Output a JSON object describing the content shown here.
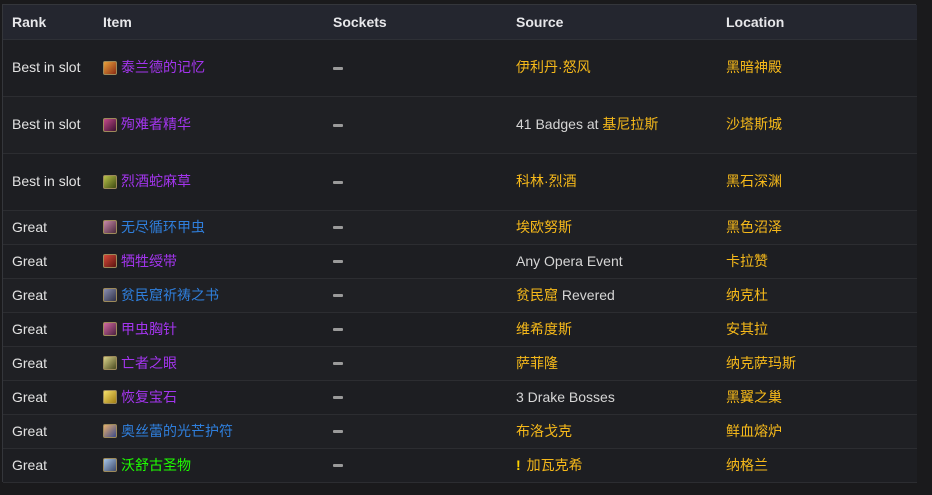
{
  "columns": [
    "Rank",
    "Item",
    "Sockets",
    "Source",
    "Location"
  ],
  "colors": {
    "epic": "#a335ee",
    "rare": "#2f7fdd",
    "uncommon": "#1eff00",
    "gold_link": "#f6b91a",
    "header_bg": "#24262f",
    "row_bg": "#1d1e22"
  },
  "rows": [
    {
      "rank": "Best in slot",
      "item": "泰兰德的记忆",
      "item_quality": "epic",
      "icon": "tear-icon",
      "sockets": "—",
      "source_parts": [
        {
          "text": "伊利丹·怒风",
          "style": "gold"
        }
      ],
      "location": "黑暗神殿"
    },
    {
      "rank": "Best in slot",
      "item": "殉难者精华",
      "item_quality": "epic",
      "icon": "essence-icon",
      "sockets": "—",
      "source_parts": [
        {
          "text": "41 Badges at ",
          "style": "plain"
        },
        {
          "text": "基尼拉斯",
          "style": "gold"
        }
      ],
      "location": "沙塔斯城"
    },
    {
      "rank": "Best in slot",
      "item": "烈酒蛇麻草",
      "item_quality": "epic",
      "icon": "hops-icon",
      "sockets": "—",
      "source_parts": [
        {
          "text": "科林·烈酒",
          "style": "gold"
        }
      ],
      "location": "黑石深渊"
    },
    {
      "rank": "Great",
      "item": "无尽循环甲虫",
      "item_quality": "rare",
      "icon": "scarab-icon",
      "sockets": "—",
      "source_parts": [
        {
          "text": "埃欧努斯",
          "style": "gold"
        }
      ],
      "location": "黑色沼泽"
    },
    {
      "rank": "Great",
      "item": "牺牲绶带",
      "item_quality": "epic",
      "icon": "ribbon-icon",
      "sockets": "—",
      "source_parts": [
        {
          "text": "Any Opera Event",
          "style": "plain"
        }
      ],
      "location": "卡拉赞"
    },
    {
      "rank": "Great",
      "item": "贫民窟祈祷之书",
      "item_quality": "rare",
      "icon": "book-icon",
      "sockets": "—",
      "source_parts": [
        {
          "text": "贫民窟",
          "style": "gold"
        },
        {
          "text": " Revered",
          "style": "plain"
        }
      ],
      "location": "纳克杜"
    },
    {
      "rank": "Great",
      "item": "甲虫胸针",
      "item_quality": "epic",
      "icon": "brooch-icon",
      "sockets": "—",
      "source_parts": [
        {
          "text": "维希度斯",
          "style": "gold"
        }
      ],
      "location": "安其拉"
    },
    {
      "rank": "Great",
      "item": "亡者之眼",
      "item_quality": "epic",
      "icon": "eye-icon",
      "sockets": "—",
      "source_parts": [
        {
          "text": "萨菲隆",
          "style": "gold"
        }
      ],
      "location": "纳克萨玛斯"
    },
    {
      "rank": "Great",
      "item": "恢复宝石",
      "item_quality": "epic",
      "icon": "gem-icon",
      "sockets": "—",
      "source_parts": [
        {
          "text": "3 Drake Bosses",
          "style": "plain"
        }
      ],
      "location": "黑翼之巢"
    },
    {
      "rank": "Great",
      "item": "奥丝蕾的光芒护符",
      "item_quality": "rare",
      "icon": "talisman-icon",
      "sockets": "—",
      "source_parts": [
        {
          "text": "布洛戈克",
          "style": "gold"
        }
      ],
      "location": "鲜血熔炉"
    },
    {
      "rank": "Great",
      "item": "沃舒古圣物",
      "item_quality": "uncommon",
      "icon": "relic-icon",
      "sockets": "—",
      "source_parts": [
        {
          "text": "!",
          "style": "bang"
        },
        {
          "text": "加瓦克希",
          "style": "gold"
        }
      ],
      "location": "纳格兰"
    }
  ]
}
